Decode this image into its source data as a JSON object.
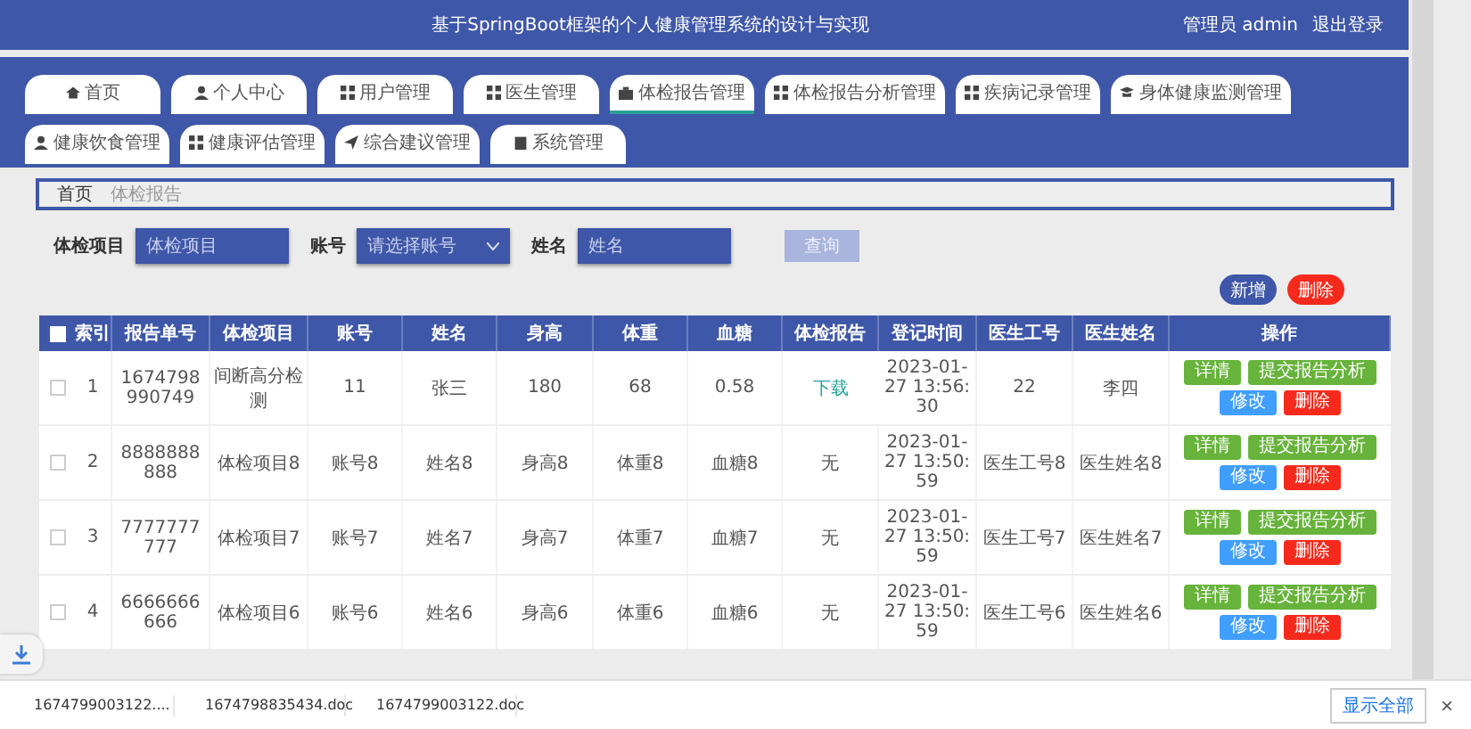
{
  "header": {
    "title": "基于SpringBoot框架的个人健康管理系统的设计与实现",
    "user": "管理员 admin",
    "logout": "退出登录"
  },
  "nav": [
    {
      "label": "首页",
      "selected": false
    },
    {
      "label": "个人中心",
      "selected": false
    },
    {
      "label": "用户管理",
      "selected": false
    },
    {
      "label": "医生管理",
      "selected": false
    },
    {
      "label": "体检报告管理",
      "selected": true
    },
    {
      "label": "体检报告分析管理",
      "selected": false
    },
    {
      "label": "疾病记录管理",
      "selected": false
    },
    {
      "label": "身体健康监测管理",
      "selected": false
    },
    {
      "label": "健康饮食管理",
      "selected": false
    },
    {
      "label": "健康评估管理",
      "selected": false
    },
    {
      "label": "综合建议管理",
      "selected": false
    },
    {
      "label": "系统管理",
      "selected": false
    }
  ],
  "breadcrumb": [
    "首页",
    "体检报告"
  ],
  "search": {
    "fields": [
      {
        "label": "体检项目",
        "kind": "input",
        "placeholder": "体检项目"
      },
      {
        "label": "账号",
        "kind": "select",
        "placeholder": "请选择账号"
      },
      {
        "label": "姓名",
        "kind": "input",
        "placeholder": "姓名"
      }
    ],
    "button": "查询"
  },
  "actions": [
    "新增",
    "删除"
  ],
  "table": {
    "select_all": false,
    "columns": [
      "索引",
      "报告单号",
      "体检项目",
      "账号",
      "姓名",
      "身高",
      "体重",
      "血糖",
      "体检报告",
      "登记时间",
      "医生工号",
      "医生姓名",
      "操作"
    ],
    "rows": [
      {
        "checked": false,
        "cells": [
          "1",
          "1674798990749",
          "间断高分检测",
          "11",
          "张三",
          "180",
          "68",
          "0.58"
        ],
        "report": {
          "kind": "link",
          "text": "下载"
        },
        "tail": [
          "2023-01-27 13:56:30",
          "22",
          "李四"
        ],
        "actions": [
          "详情",
          "提交报告分析",
          "修改",
          "删除"
        ]
      },
      {
        "checked": false,
        "cells": [
          "2",
          "8888888888",
          "体检项目8",
          "账号8",
          "姓名8",
          "身高8",
          "体重8",
          "血糖8"
        ],
        "report": {
          "kind": "text",
          "text": "无"
        },
        "tail": [
          "2023-01-27 13:50:59",
          "医生工号8",
          "医生姓名8"
        ],
        "actions": [
          "详情",
          "提交报告分析",
          "修改",
          "删除"
        ]
      },
      {
        "checked": false,
        "cells": [
          "3",
          "7777777777",
          "体检项目7",
          "账号7",
          "姓名7",
          "身高7",
          "体重7",
          "血糖7"
        ],
        "report": {
          "kind": "text",
          "text": "无"
        },
        "tail": [
          "2023-01-27 13:50:59",
          "医生工号7",
          "医生姓名7"
        ],
        "actions": [
          "详情",
          "提交报告分析",
          "修改",
          "删除"
        ]
      },
      {
        "checked": false,
        "cells": [
          "4",
          "6666666666",
          "体检项目6",
          "账号6",
          "姓名6",
          "身高6",
          "体重6",
          "血糖6"
        ],
        "report": {
          "kind": "text",
          "text": "无"
        },
        "tail": [
          "2023-01-27 13:50:59",
          "医生工号6",
          "医生姓名6"
        ],
        "actions": [
          "详情",
          "提交报告分析",
          "修改",
          "删除"
        ]
      }
    ]
  },
  "downloads": {
    "files": [
      "1674799003122....",
      "1674798835434.doc",
      "1674799003122.doc"
    ],
    "show_all": "显示全部",
    "close": "×"
  }
}
